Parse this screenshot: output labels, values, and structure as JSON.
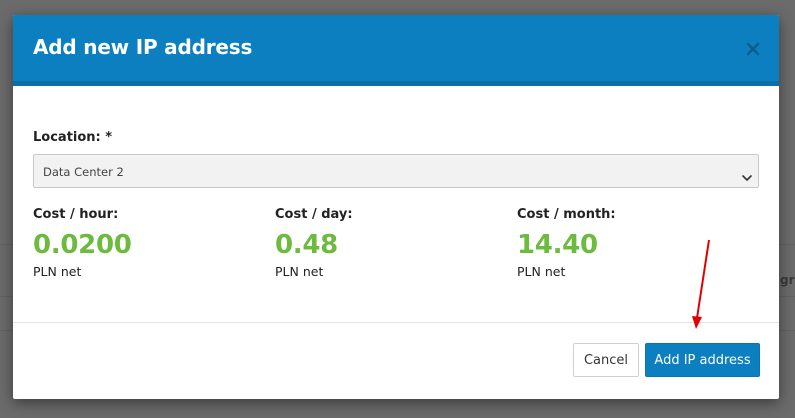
{
  "modal": {
    "title": "Add new IP address",
    "close_icon": "close-icon"
  },
  "location": {
    "label": "Location: *",
    "selected": "Data Center 2",
    "chevron_icon": "chevron-down-icon"
  },
  "costs": [
    {
      "label": "Cost / hour:",
      "value": "0.0200",
      "unit": "PLN net"
    },
    {
      "label": "Cost / day:",
      "value": "0.48",
      "unit": "PLN net"
    },
    {
      "label": "Cost / month:",
      "value": "14.40",
      "unit": "PLN net"
    }
  ],
  "footer": {
    "cancel_label": "Cancel",
    "submit_label": "Add IP address"
  },
  "background": {
    "fragment_text": "gr"
  },
  "colors": {
    "header": "#0b7fbf",
    "cost_value": "#6cbb3f",
    "primary_button": "#0b7fbf",
    "annotation_arrow": "#e00000"
  }
}
